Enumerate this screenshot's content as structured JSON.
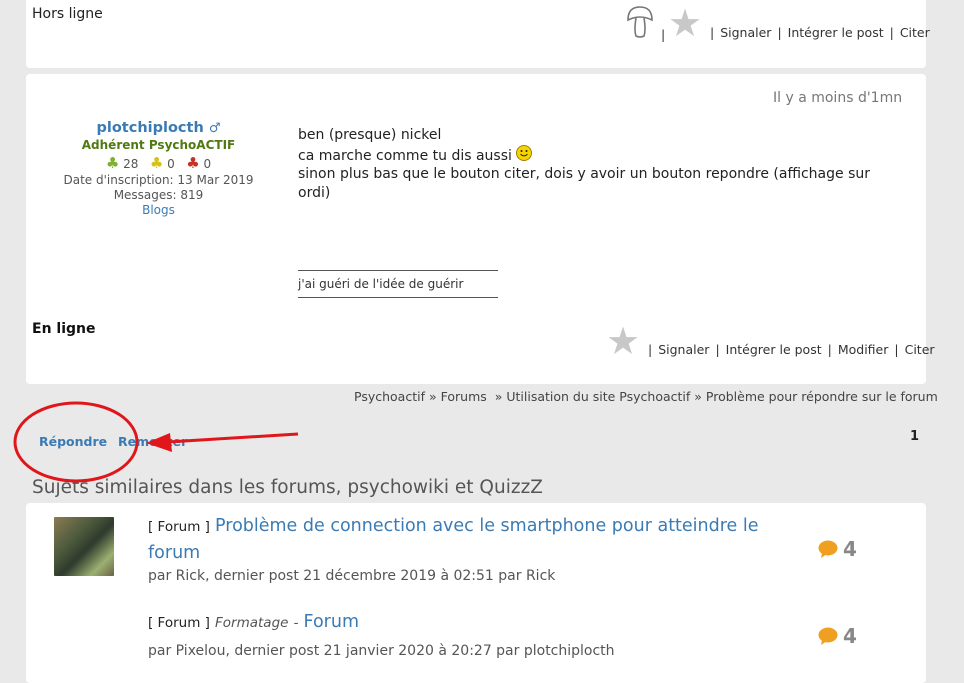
{
  "post1": {
    "status": "Hors ligne",
    "separator": "|",
    "links": [
      "Signaler",
      "Intégrer le post",
      "Citer"
    ]
  },
  "post2": {
    "time": "Il y a moins d'1mn",
    "author": {
      "name": "plotchiplocth",
      "gender_symbol": "♂",
      "role": "Adhérent PsychoACTIF",
      "counts": {
        "green": "28",
        "yellow": "0",
        "red": "0"
      },
      "join": "Date d'inscription: 13 Mar 2019",
      "messages": "Messages: 819",
      "blogs": "Blogs"
    },
    "body": {
      "line1": "ben (presque) nickel",
      "line2": "ca marche comme tu dis aussi",
      "line3": "sinon plus bas que le bouton citer, dois y avoir un bouton repondre (affichage sur ordi)"
    },
    "signature": "j'ai guéri de l'idée de guérir",
    "status": "En ligne",
    "separator": "|",
    "links": [
      "Signaler",
      "Intégrer le post",
      "Modifier",
      "Citer"
    ]
  },
  "breadcrumb": {
    "items": [
      "Psychoactif",
      "Forums",
      "Utilisation du site Psychoactif",
      "Problème pour répondre sur le forum"
    ],
    "separator": "»"
  },
  "actions": {
    "reply": "Répondre",
    "top": "Remonter",
    "page": "1"
  },
  "similar": {
    "heading": "Sujets similaires dans les forums, psychowiki et QuizzZ",
    "items": [
      {
        "tag": "[ Forum ]",
        "title": "Problème de connection avec le smartphone pour atteindre le forum",
        "meta": "par Rick, dernier post 21 décembre 2019 à  02:51 par Rick",
        "count": "4"
      },
      {
        "tag": "[ Forum ]",
        "category": "Formatage",
        "dash": "-",
        "title": "Forum",
        "meta": "par Pixelou, dernier post 21 janvier 2020 à  20:27 par plotchiplocth",
        "count": "4"
      }
    ]
  },
  "colors": {
    "link": "#3b7bb3",
    "role": "#4f7a12",
    "annotation": "#e0161b",
    "bubble": "#f0a020"
  }
}
